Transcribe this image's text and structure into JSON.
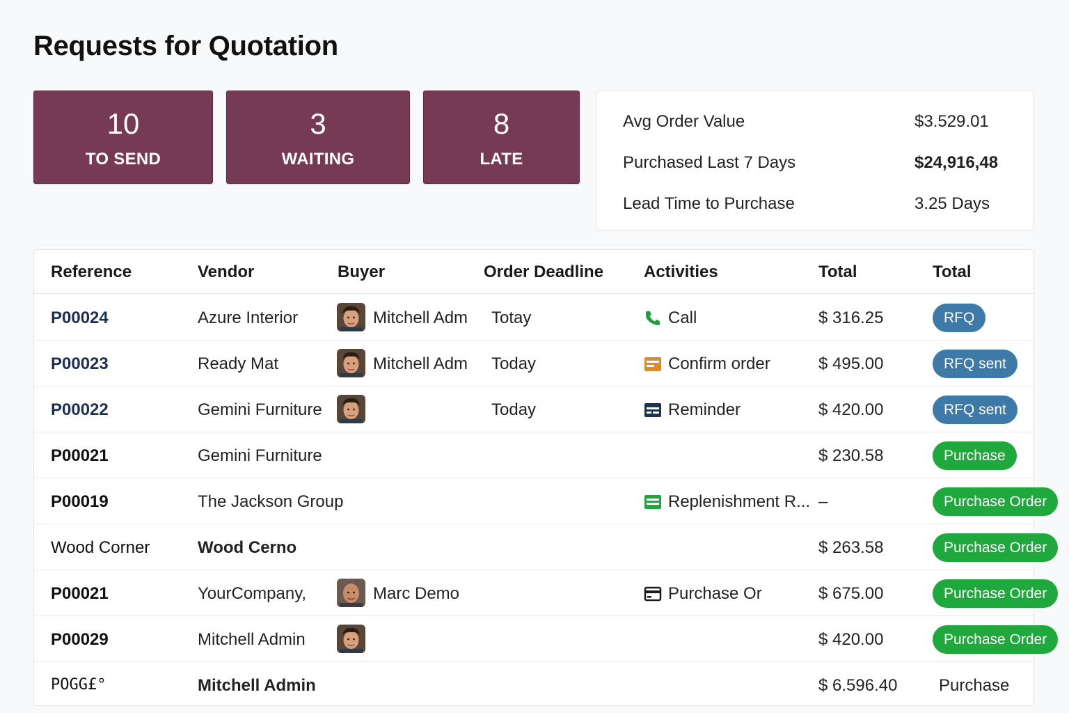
{
  "page": {
    "title": "Requests for Quotation"
  },
  "kpis": [
    {
      "number": "10",
      "label": "TO SEND"
    },
    {
      "number": "3",
      "label": "WAITING"
    },
    {
      "number": "8",
      "label": "LATE"
    }
  ],
  "stats": [
    {
      "label": "Avg Order Value",
      "value": "$3.529.01"
    },
    {
      "label": "Purchased Last 7 Days",
      "value": "$24,916,48"
    },
    {
      "label": "Lead Time to Purchase",
      "value": "3.25 Days"
    }
  ],
  "table": {
    "headers": [
      "Reference",
      "Vendor",
      "Buyer",
      "Order Deadline",
      "Activities",
      "Total",
      "Total"
    ],
    "rows": [
      {
        "reference": "P00024",
        "vendor": "Azure Interior",
        "buyer": "Mitchell Adm",
        "deadline": "Totay",
        "activity": "Call",
        "activity_icon": "phone-icon",
        "total": "$ 316.25",
        "status": "RFQ"
      },
      {
        "reference": "P00023",
        "vendor": "Ready Mat",
        "buyer": "Mitchell Adm",
        "deadline": "Today",
        "activity": "Confirm order",
        "activity_icon": "confirm-order-icon",
        "total": "$ 495.00",
        "status": "RFQ sent"
      },
      {
        "reference": "P00022",
        "vendor": "Gemini Furniture",
        "buyer": "",
        "deadline": "Today",
        "activity": "Reminder",
        "activity_icon": "reminder-icon",
        "total": "$ 420.00",
        "status": "RFQ sent"
      },
      {
        "reference": "P00021",
        "vendor": "Gemini Furniture",
        "buyer": "",
        "deadline": "",
        "activity": "",
        "total": "$ 230.58",
        "status": "Purchase"
      },
      {
        "reference": "P00019",
        "vendor": "The Jackson Group",
        "buyer": "",
        "deadline": "",
        "activity": "Replenishment R...",
        "activity_icon": "replenishment-icon",
        "total": "–",
        "status": "Purchase Order"
      },
      {
        "reference": "Wood Corner",
        "vendor": "Wood Cerno",
        "buyer": "",
        "deadline": "",
        "activity": "",
        "total": "$ 263.58",
        "status": "Purchase Order"
      },
      {
        "reference": "P00021",
        "vendor": "YourCompany,",
        "buyer": "Marc Demo",
        "deadline": "",
        "activity": "Purchase Or",
        "activity_icon": "purchase-order-icon",
        "total": "$ 675.00",
        "status": "Purchase Order"
      },
      {
        "reference": "P00029",
        "vendor": "Mitchell Admin",
        "buyer": "",
        "deadline": "",
        "activity": "",
        "total": "$ 420.00",
        "status": "Purchase Order"
      },
      {
        "reference": "POGG£°",
        "vendor": "Mitchell Admin",
        "buyer": "",
        "deadline": "",
        "activity": "",
        "total": "$ 6.596.40",
        "status": "Purchase"
      }
    ]
  },
  "colors": {
    "kpi_background": "#773a55",
    "status_blue": "#3e7aa7",
    "status_green": "#1fa83c",
    "reference_link": "#1c2f55"
  }
}
